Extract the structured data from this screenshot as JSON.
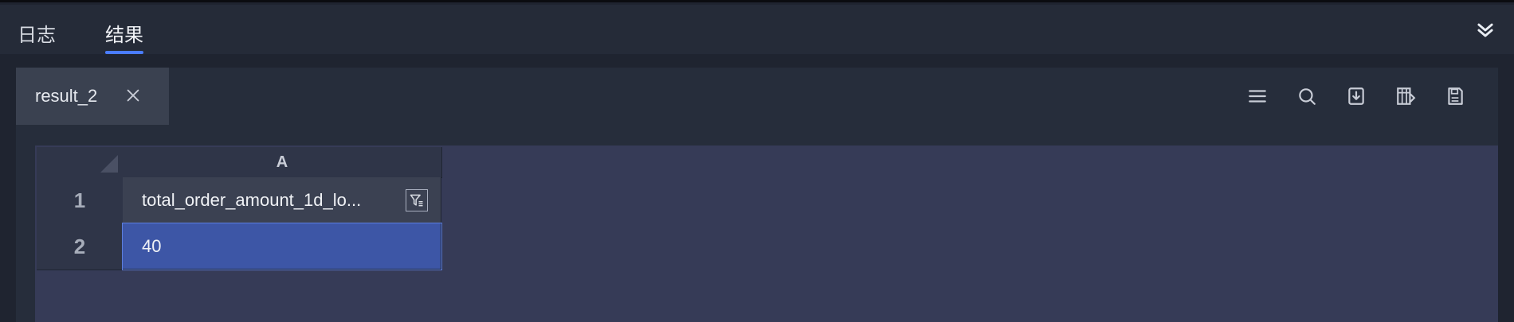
{
  "top_tabs": {
    "logs_label": "日志",
    "result_label": "结果",
    "active": "结果"
  },
  "result_tabs": {
    "active_label": "result_2"
  },
  "toolbar": {
    "icons": [
      "menu-icon",
      "search-icon",
      "download-icon",
      "column-settings-icon",
      "save-icon"
    ]
  },
  "grid": {
    "column_header": "A",
    "rows": [
      {
        "number": "1",
        "value": "total_order_amount_1d_lo..."
      },
      {
        "number": "2",
        "value": "40"
      }
    ]
  },
  "colors": {
    "accent": "#4a7cff",
    "selected_cell": "#3d56a6",
    "panel": "#363b57"
  }
}
